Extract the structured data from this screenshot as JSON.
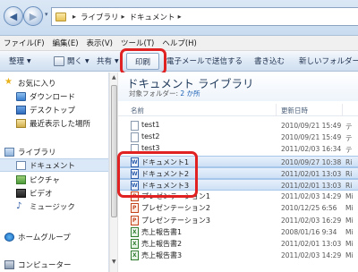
{
  "address": {
    "crumbs": [
      "ライブラリ",
      "ドキュメント"
    ],
    "separator": "▸",
    "back_glyph": "◀",
    "forward_glyph": "▶"
  },
  "menu": [
    "ファイル(F)",
    "編集(E)",
    "表示(V)",
    "ツール(T)",
    "ヘルプ(H)"
  ],
  "toolbar": {
    "organize": "整理",
    "open": "開く",
    "share": "共有",
    "print": "印刷",
    "email": "電子メールで送信する",
    "burn": "書き込む",
    "new_folder": "新しいフォルダー"
  },
  "nav": {
    "favorites": "お気に入り",
    "downloads": "ダウンロード",
    "desktop": "デスクトップ",
    "recent": "最近表示した場所",
    "libraries": "ライブラリ",
    "documents": "ドキュメント",
    "pictures": "ピクチャ",
    "videos": "ビデオ",
    "music": "ミュージック",
    "homegroup": "ホームグループ",
    "computer": "コンピューター"
  },
  "library": {
    "title": "ドキュメント ライブラリ",
    "subtitle_prefix": "対象フォルダー:",
    "subtitle_link": "2 か所"
  },
  "columns": {
    "name": "名前",
    "date": "更新日時"
  },
  "files": [
    {
      "name": "test1",
      "date": "2010/09/21 15:49",
      "type": "テ",
      "kind": "txt",
      "selected": false
    },
    {
      "name": "test2",
      "date": "2010/09/21 15:49",
      "type": "テ",
      "kind": "txt",
      "selected": false
    },
    {
      "name": "test3",
      "date": "2011/02/03 16:34",
      "type": "テ",
      "kind": "txt",
      "selected": false
    },
    {
      "name": "ドキュメント1",
      "date": "2010/09/27 10:38",
      "type": "Ri",
      "kind": "word",
      "selected": true
    },
    {
      "name": "ドキュメント2",
      "date": "2011/02/01 13:03",
      "type": "Ri",
      "kind": "word",
      "selected": true
    },
    {
      "name": "ドキュメント3",
      "date": "2011/02/01 13:03",
      "type": "Ri",
      "kind": "word",
      "selected": true
    },
    {
      "name": "プレゼンテーション1",
      "date": "2011/02/03 14:29",
      "type": "Mi",
      "kind": "ppt",
      "selected": false
    },
    {
      "name": "プレゼンテーション2",
      "date": "2010/12/25 6:56",
      "type": "Mi",
      "kind": "ppt",
      "selected": false
    },
    {
      "name": "プレゼンテーション3",
      "date": "2011/02/03 16:29",
      "type": "Mi",
      "kind": "ppt",
      "selected": false
    },
    {
      "name": "売上報告書1",
      "date": "2008/01/16 9:34",
      "type": "Mi",
      "kind": "xls",
      "selected": false
    },
    {
      "name": "売上報告書2",
      "date": "2011/02/01 13:03",
      "type": "Mi",
      "kind": "xls",
      "selected": false
    },
    {
      "name": "売上報告書3",
      "date": "2011/02/03 14:29",
      "type": "Mi",
      "kind": "xls",
      "selected": false
    }
  ],
  "colors": {
    "highlight": "#e02222",
    "selection": "#cde0f6",
    "title": "#1e395b",
    "link": "#1a5fb4"
  }
}
